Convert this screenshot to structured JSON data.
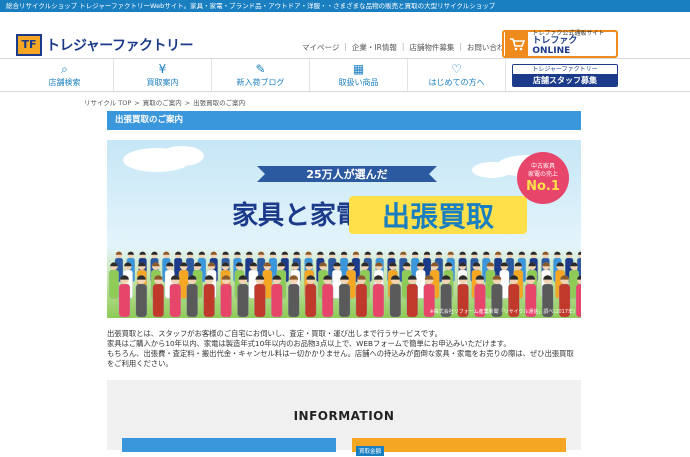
{
  "topbar": {
    "text": "総合リサイクルショップ トレジャーファクトリーWebサイト。家具・家電・ブランド品・アウトドア・洋服・・さまざまな品物の販売と買取の大型リサイクルショップ"
  },
  "logo": {
    "mark": "TF",
    "text": "トレジャーファクトリー"
  },
  "utility_links": [
    "マイページ",
    "企業・IR情報",
    "店舗物件募集",
    "お問い合わせ"
  ],
  "online": {
    "small": "トレファク公式通販サイト",
    "big": "トレファク ONLINE",
    "icon": "cart-icon"
  },
  "nav": [
    {
      "label": "店舗検索",
      "icon": "store-search-icon",
      "glyph": "⌕"
    },
    {
      "label": "買取案内",
      "icon": "purchase-guide-icon",
      "glyph": "¥"
    },
    {
      "label": "新入荷ブログ",
      "icon": "blog-icon",
      "glyph": "✎"
    },
    {
      "label": "取扱い商品",
      "icon": "products-icon",
      "glyph": "▦"
    },
    {
      "label": "はじめての方へ",
      "icon": "beginner-icon",
      "glyph": "♡"
    }
  ],
  "staff_button": {
    "top": "トレジャーファクトリー",
    "bottom": "店舗スタッフ募集"
  },
  "breadcrumb": [
    "リサイクル TOP",
    "買取のご案内",
    "出張買取のご案内"
  ],
  "section_title": "出張買取のご案内",
  "banner": {
    "ribbon": "25万人が選んだ",
    "headline_a": "家具と家電の",
    "headline_b": "出張買取",
    "badge_small": "中古家具\n家電の売上",
    "badge_line1": "中古家具",
    "badge_line2": "家電の売上",
    "badge_big": "No.1",
    "footnote": "※株式会社リフォーム産業新聞「リサイクル通信」調べ(2017年)"
  },
  "description": [
    "出張買取とは、スタッフがお客様のご自宅にお伺いし、査定・買取・運び出しまで行うサービスです。",
    "家具はご購入から10年以内、家電は製造年式10年以内のお品物3点以上で、WEBフォームで簡単にお申込みいただけます。",
    "もちろん、出張費・査定料・搬出代金・キャンセル料は一切かかりません。店舗への持込みが面倒な家具・家電をお売りの際は、ぜひ出張買取をご利用ください。"
  ],
  "information": {
    "title": "INFORMATION",
    "card_right_tag": "買取金額"
  },
  "colors": {
    "brand_blue": "#1a7fc1",
    "navy": "#1b3a8a",
    "orange": "#ef8a1c",
    "title_blue": "#3b97dc"
  }
}
